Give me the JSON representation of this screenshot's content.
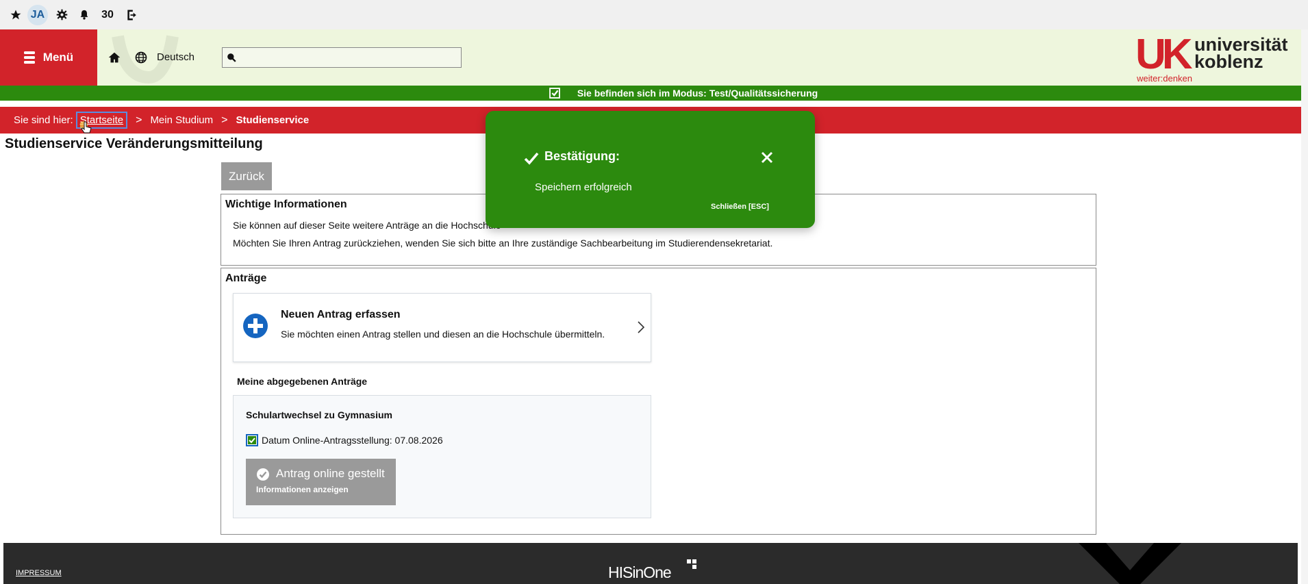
{
  "topbar": {
    "initials": "JA",
    "notification_count": "30"
  },
  "header": {
    "menu_label": "Menü",
    "language": "Deutsch",
    "search_placeholder": "",
    "logo_mark": "UK",
    "logo_line1": "universität",
    "logo_line2": "koblenz",
    "logo_tagline": "weiter:denken"
  },
  "modebar": {
    "text": "Sie befinden sich im Modus: Test/Qualitätssicherung"
  },
  "breadcrumb": {
    "prefix": "Sie sind hier:",
    "items": [
      "Startseite",
      "Mein Studium",
      "Studienservice"
    ]
  },
  "page": {
    "title": "Studienservice Veränderungsmitteilung",
    "back_label": "Zurück"
  },
  "info_panel": {
    "title": "Wichtige Informationen",
    "line1": "Sie können auf dieser Seite weitere Anträge an die Hochschule",
    "line2": "Möchten Sie Ihren Antrag zurückziehen, wenden Sie sich bitte an Ihre zuständige Sachbearbeitung im Studierendensekretariat."
  },
  "antraege_panel": {
    "title": "Anträge",
    "new_title": "Neuen Antrag erfassen",
    "new_subtitle": "Sie möchten einen Antrag stellen und diesen an die Hochschule übermitteln.",
    "my_title": "Meine abgegebenen Anträge",
    "my_item": {
      "title": "Schulartwechsel zu Gymnasium",
      "date_label": "Datum Online-Antragsstellung: 07.08.2026",
      "status_label": "Antrag online gestellt",
      "status_sub": "Informationen anzeigen"
    }
  },
  "footer": {
    "impressum": "IMPRESSUM",
    "brand": "HISinOne"
  },
  "toast": {
    "title": "Bestätigung:",
    "message": "Speichern erfolgreich",
    "close_label": "Schließen [ESC]"
  },
  "colors": {
    "brand_red": "#d2232a",
    "success_green": "#2c8a0e",
    "header_bg": "#eef6dd",
    "button_grey": "#9a9a9a"
  }
}
